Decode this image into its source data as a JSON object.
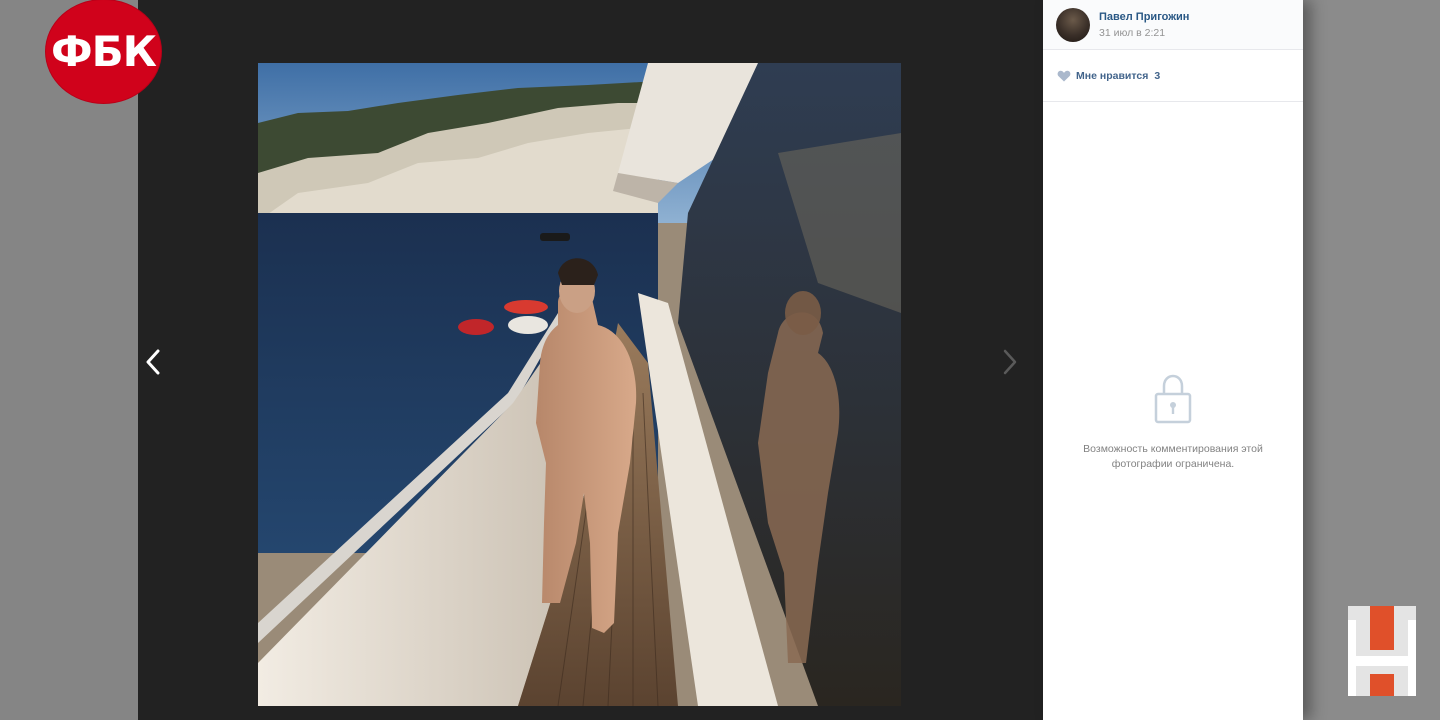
{
  "overlay": {
    "fbk_logo_text": "ФБК"
  },
  "viewer": {
    "prev_icon": "chevron-left-icon",
    "next_icon": "chevron-right-icon"
  },
  "post": {
    "author_name": "Павел Пригожин",
    "date": "31 июл в 2:21",
    "likes_label": "Мне нравится",
    "likes_count": "3",
    "comments_restricted_text": "Возможность комментирования этой\nфотографии ограничена."
  },
  "colors": {
    "brand_red": "#d0021b",
    "link_blue": "#2a5885",
    "channel_orange": "#e0502a"
  }
}
